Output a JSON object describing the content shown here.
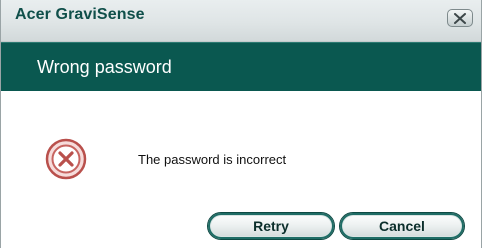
{
  "window": {
    "app_title": "Acer GraviSense",
    "close_icon": "close-x-icon"
  },
  "header": {
    "title": "Wrong password"
  },
  "dialog": {
    "icon": "error-icon",
    "message": "The password is incorrect"
  },
  "buttons": {
    "retry_label": "Retry",
    "cancel_label": "Cancel"
  },
  "colors": {
    "header_band": "#0a5850",
    "app_title": "#0f4f4a",
    "error_icon": "#c0504d"
  }
}
